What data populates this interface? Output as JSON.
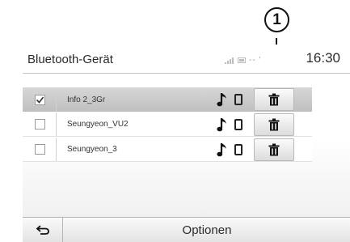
{
  "callout": {
    "number": "1"
  },
  "header": {
    "title": "Bluetooth-Gerät",
    "status_dashes": "--",
    "status_mark": "'",
    "clock": "16:30"
  },
  "devices": [
    {
      "name": "Info 2_3Gr",
      "selected": true,
      "checked": true,
      "icons": [
        "music-note-icon",
        "phone-icon",
        "trash-icon"
      ]
    },
    {
      "name": "Seungyeon_VU2",
      "selected": false,
      "checked": false,
      "icons": [
        "music-note-icon",
        "phone-icon",
        "trash-icon"
      ]
    },
    {
      "name": "Seungyeon_3",
      "selected": false,
      "checked": false,
      "icons": [
        "music-note-icon",
        "phone-icon",
        "trash-icon"
      ]
    }
  ],
  "footer": {
    "back_icon": "back-arrow-icon",
    "options_label": "Optionen"
  }
}
